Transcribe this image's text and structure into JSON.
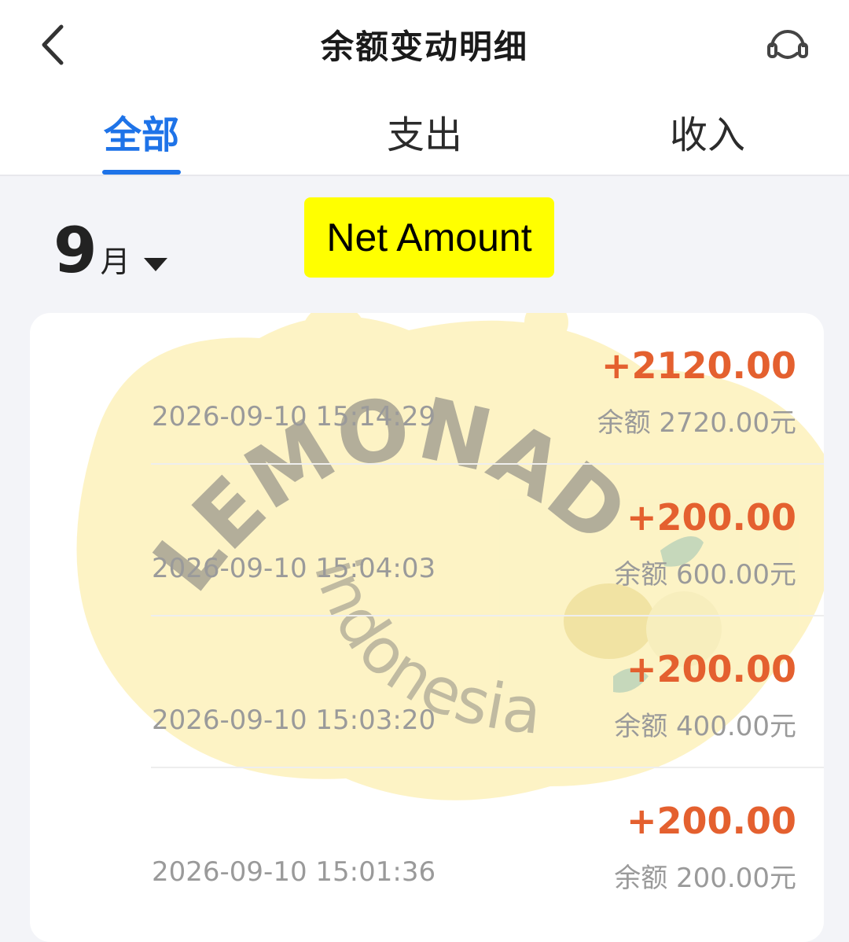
{
  "header": {
    "title": "余额变动明细",
    "back_icon": "back-arrow-icon",
    "support_icon": "customer-service-icon"
  },
  "tabs": [
    {
      "label": "全部",
      "active": true
    },
    {
      "label": "支出",
      "active": false
    },
    {
      "label": "收入",
      "active": false
    }
  ],
  "month": {
    "number": "9",
    "unit": "月"
  },
  "overlay_label": "Net Amount",
  "watermark": {
    "line1": "LEMONADE",
    "line2": "indonesia"
  },
  "transactions": [
    {
      "amount": "+2120.00",
      "time": "2026-09-10 15:14:29",
      "balance": "余额 2720.00元"
    },
    {
      "amount": "+200.00",
      "time": "2026-09-10 15:04:03",
      "balance": "余额 600.00元"
    },
    {
      "amount": "+200.00",
      "time": "2026-09-10 15:03:20",
      "balance": "余额 400.00元"
    },
    {
      "amount": "+200.00",
      "time": "2026-09-10 15:01:36",
      "balance": "余额 200.00元"
    }
  ],
  "colors": {
    "accent": "#1e73e8",
    "amount": "#e4602f",
    "highlight": "#ffff00"
  }
}
